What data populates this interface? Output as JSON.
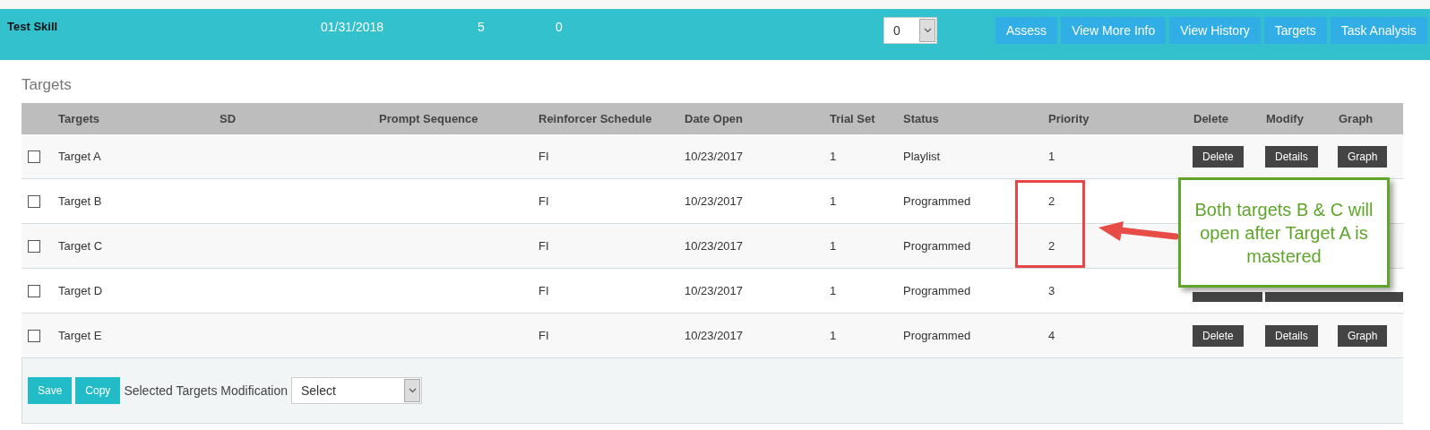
{
  "skill_bar": {
    "name": "Test Skill",
    "date": "01/31/2018",
    "count_1": "5",
    "count_2": "0",
    "dropdown": {
      "value": "0"
    },
    "buttons": [
      "Assess",
      "View More Info",
      "View History",
      "Targets",
      "Task Analysis"
    ]
  },
  "section_title": "Targets",
  "table": {
    "columns": [
      "Targets",
      "SD",
      "Prompt Sequence",
      "Reinforcer Schedule",
      "Date Open",
      "Trial Set",
      "Status",
      "Priority",
      "Delete",
      "Modify",
      "Graph"
    ],
    "rows": [
      {
        "checked": false,
        "target": "Target A",
        "reinforcer_schedule": "FI",
        "date_open": "10/23/2017",
        "trial_set": "1",
        "status": "Playlist",
        "priority": "1",
        "actions": [
          "Delete",
          "Details",
          "Graph"
        ]
      },
      {
        "checked": false,
        "target": "Target B",
        "reinforcer_schedule": "FI",
        "date_open": "10/23/2017",
        "trial_set": "1",
        "status": "Programmed",
        "priority": "2"
      },
      {
        "checked": false,
        "target": "Target C",
        "reinforcer_schedule": "FI",
        "date_open": "10/23/2017",
        "trial_set": "1",
        "status": "Programmed",
        "priority": "2"
      },
      {
        "checked": false,
        "target": "Target D",
        "reinforcer_schedule": "FI",
        "date_open": "10/23/2017",
        "trial_set": "1",
        "status": "Programmed",
        "priority": "3",
        "actions_covered": true
      },
      {
        "checked": false,
        "target": "Target E",
        "reinforcer_schedule": "FI",
        "date_open": "10/23/2017",
        "trial_set": "1",
        "status": "Programmed",
        "priority": "4",
        "actions": [
          "Delete",
          "Details",
          "Graph"
        ]
      }
    ]
  },
  "footer": {
    "buttons": [
      "Save",
      "Copy"
    ],
    "label": "Selected Targets Modification",
    "dropdown": {
      "value": "Select"
    }
  },
  "annotation": {
    "callout": "Both targets B & C will open after Target A is mastered"
  }
}
